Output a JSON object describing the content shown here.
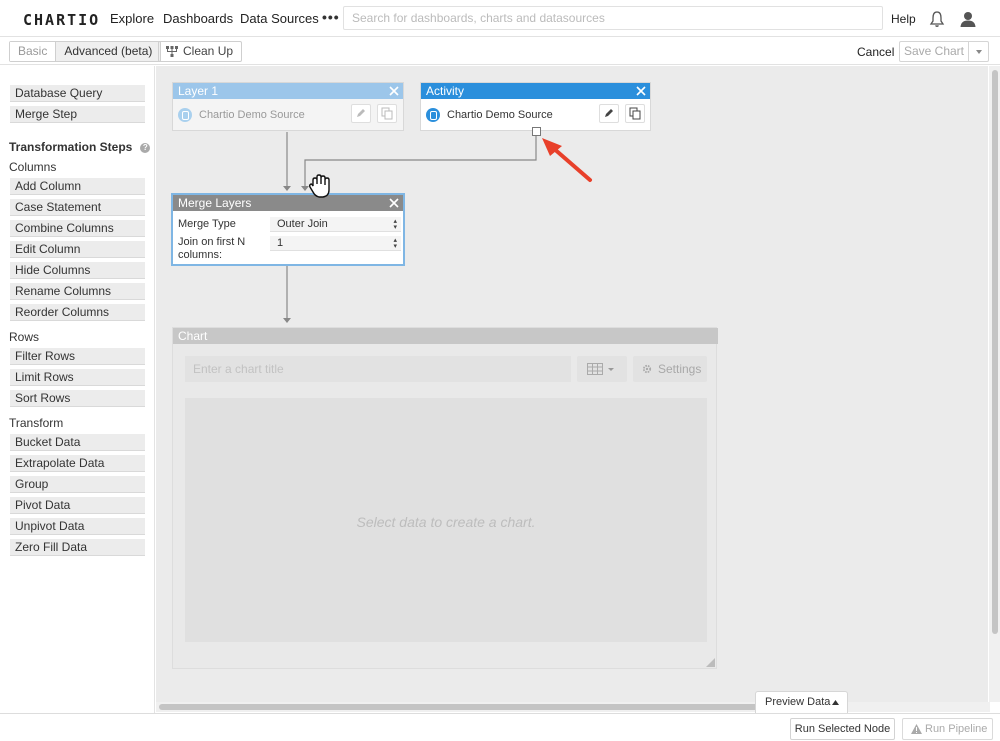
{
  "app": {
    "logo": "CHARTIO"
  },
  "nav": {
    "links": [
      "Explore",
      "Dashboards",
      "Data Sources"
    ],
    "more": "•••",
    "search_placeholder": "Search for dashboards, charts and datasources",
    "help": "Help"
  },
  "toolbar": {
    "mode_basic": "Basic",
    "mode_advanced": "Advanced (beta)",
    "cleanup": "Clean Up",
    "cancel": "Cancel",
    "save_chart": "Save Chart"
  },
  "sidebar": {
    "top_items": [
      "Database Query",
      "Merge Step"
    ],
    "transformation_title": "Transformation Steps",
    "sections": [
      {
        "title": "Columns",
        "items": [
          "Add Column",
          "Case Statement",
          "Combine Columns",
          "Edit Column",
          "Hide Columns",
          "Rename Columns",
          "Reorder Columns"
        ]
      },
      {
        "title": "Rows",
        "items": [
          "Filter Rows",
          "Limit Rows",
          "Sort Rows"
        ]
      },
      {
        "title": "Transform",
        "items": [
          "Bucket Data",
          "Extrapolate Data",
          "Group",
          "Pivot Data",
          "Unpivot Data",
          "Zero Fill Data"
        ]
      }
    ]
  },
  "nodes": {
    "layer1": {
      "title": "Layer 1",
      "source": "Chartio Demo Source",
      "header_color": "#9cc6ea"
    },
    "activity": {
      "title": "Activity",
      "source": "Chartio Demo Source",
      "header_color": "#2b8fdc"
    },
    "merge": {
      "title": "Merge Layers",
      "merge_type_label": "Merge Type",
      "merge_type_value": "Outer Join",
      "join_label_1": "Join on first N",
      "join_label_2": "columns:",
      "join_value": "1",
      "header_color": "#8a8a8a"
    }
  },
  "chart": {
    "title": "Chart",
    "title_placeholder": "Enter a chart title",
    "settings": "Settings",
    "empty_message": "Select data to create a chart."
  },
  "bottom": {
    "preview": "Preview Data",
    "run_selected": "Run Selected Node",
    "run_pipeline": "Run Pipeline"
  },
  "colors": {
    "annotation_arrow": "#e8402a"
  }
}
